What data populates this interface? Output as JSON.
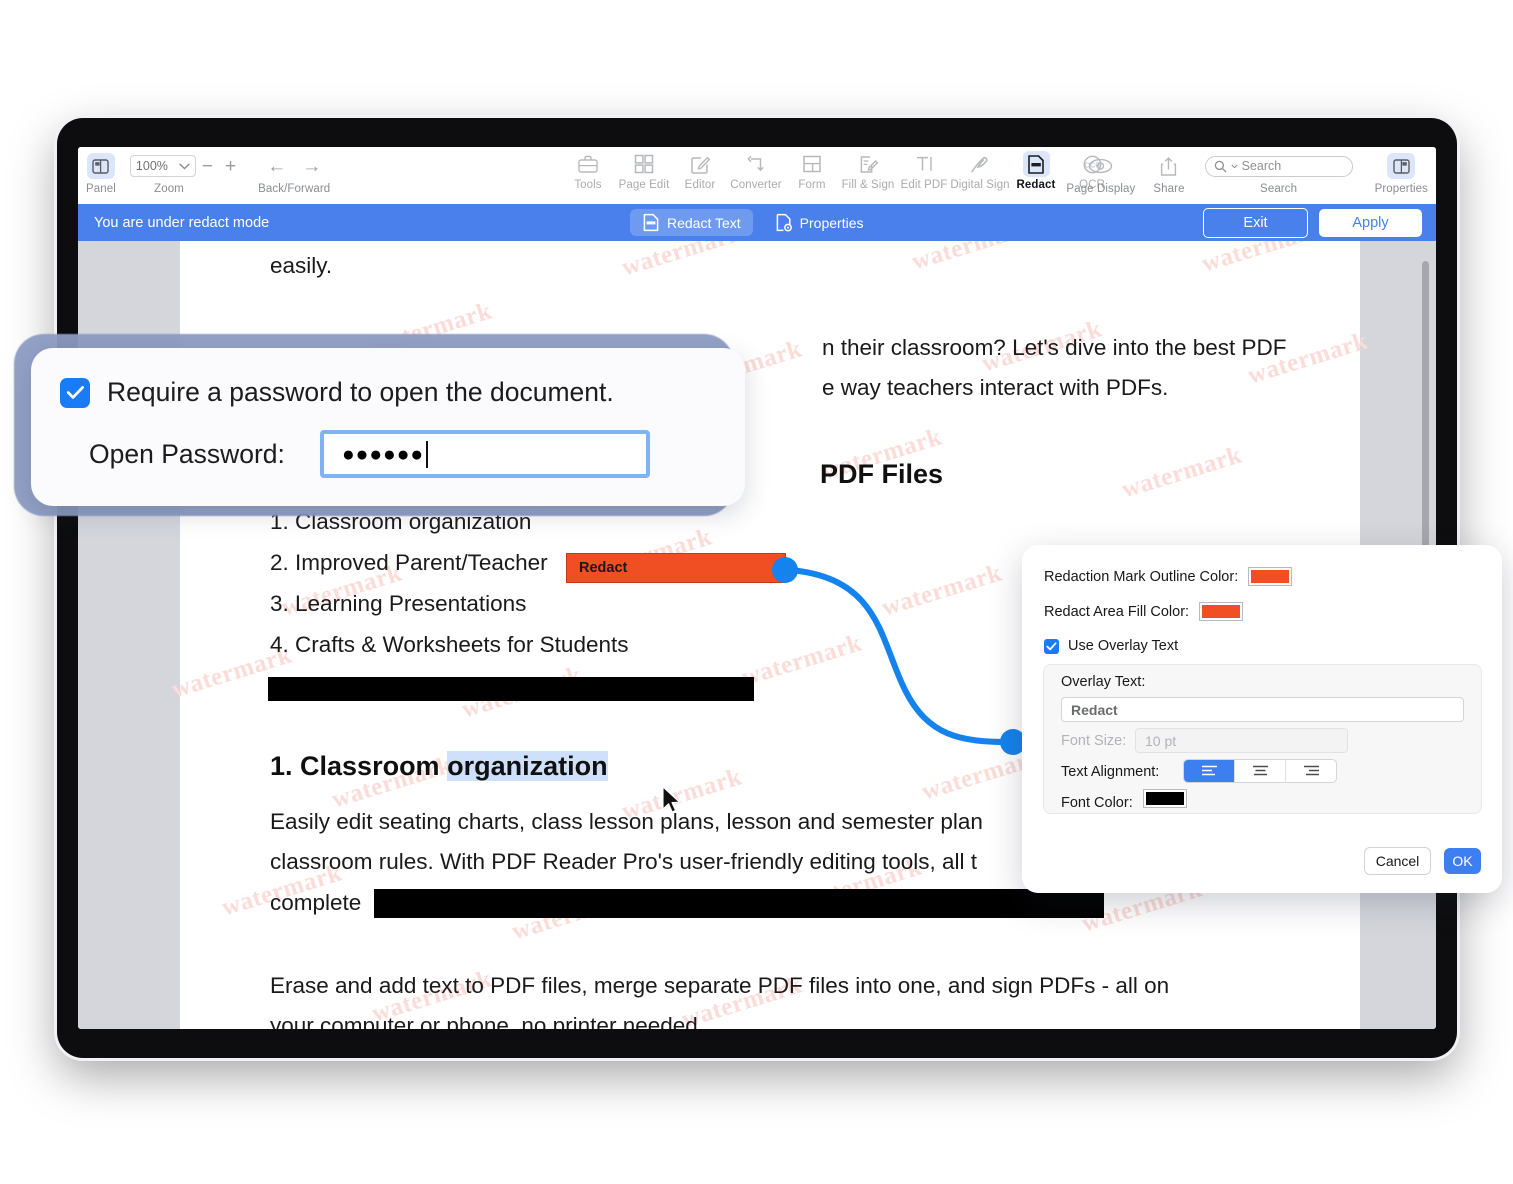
{
  "toolbar": {
    "left": [
      {
        "label": "Panel",
        "icon": "panel-icon"
      },
      {
        "label": "Zoom",
        "icon": "zoom-group",
        "value": "100%",
        "minus": "−",
        "plus": "+"
      },
      {
        "label": "Back/Forward",
        "icon": "nav-arrows",
        "back": "←",
        "forward": "→"
      }
    ],
    "center": [
      {
        "label": "Tools",
        "icon": "toolbox-icon",
        "active": false
      },
      {
        "label": "Page Edit",
        "icon": "grid-icon",
        "active": false
      },
      {
        "label": "Editor",
        "icon": "pencil-square-icon",
        "active": false
      },
      {
        "label": "Converter",
        "icon": "convert-arrows-icon",
        "active": false
      },
      {
        "label": "Form",
        "icon": "form-icon",
        "active": false
      },
      {
        "label": "Fill & Sign",
        "icon": "fill-sign-icon",
        "active": false
      },
      {
        "label": "Edit PDF",
        "icon": "text-tool-icon",
        "active": false
      },
      {
        "label": "Digital Sign",
        "icon": "signature-pen-icon",
        "active": false
      },
      {
        "label": "Redact",
        "icon": "redact-icon",
        "active": true
      },
      {
        "label": "OCR",
        "icon": "ocr-icon",
        "active": false
      }
    ],
    "right": [
      {
        "label": "Page Display",
        "icon": "eye-icon"
      },
      {
        "label": "Share",
        "icon": "share-upload-icon"
      },
      {
        "label": "Search",
        "icon": "magnifier-icon",
        "placeholder": "Search"
      },
      {
        "label": "Properties",
        "icon": "properties-panel-icon"
      }
    ]
  },
  "redact_bar": {
    "message": "You are under redact mode",
    "redact_text_label": "Redact Text",
    "properties_label": "Properties",
    "exit_label": "Exit",
    "apply_label": "Apply",
    "bar_color": "#4a80ec"
  },
  "document": {
    "line_easily": "easily.",
    "para1": "n their classroom? Let's dive into the best PDF",
    "para2": "e way teachers interact with PDFs.",
    "heading_files": "PDF Files",
    "list": [
      "1. Classroom organization",
      "2. Improved Parent/Teacher",
      "3. Learning Presentations",
      "4. Crafts & Worksheets for Students"
    ],
    "redact_overlay_label": "Redact",
    "section_heading_prefix": "1. Classroom ",
    "section_heading_selected": "organization",
    "body1": "Easily edit seating charts, class lesson plans, lesson and semester plan",
    "body2": "classroom rules. With PDF Reader Pro's user-friendly editing tools, all t",
    "body3": "complete",
    "body4": "Erase and add text to PDF files, merge separate PDF files into one, and sign PDFs - all on",
    "body5": "your computer or phone, no printer needed.",
    "watermark_text": "watermark"
  },
  "password_dialog": {
    "checkbox_label": "Require a password to open the document.",
    "checkbox_checked": true,
    "field_label": "Open Password:",
    "password_masked": "●●●●●●",
    "check_glyph": "✓"
  },
  "redaction_properties": {
    "outline_color_label": "Redaction Mark Outline Color:",
    "outline_color": "#f04e23",
    "fill_color_label": "Redact Area Fill Color:",
    "fill_color": "#f04e23",
    "use_overlay_label": "Use Overlay Text",
    "use_overlay_checked": true,
    "overlay_text_label": "Overlay Text:",
    "overlay_text_value": "Redact",
    "font_size_label": "Font Size:",
    "font_size_value": "10 pt",
    "text_alignment_label": "Text Alignment:",
    "alignment_options": [
      "align-left",
      "align-center",
      "align-right"
    ],
    "alignment_selected": "align-left",
    "font_color_label": "Font Color:",
    "font_color": "#000000",
    "cancel_label": "Cancel",
    "ok_label": "OK",
    "check_glyph": "✓"
  }
}
